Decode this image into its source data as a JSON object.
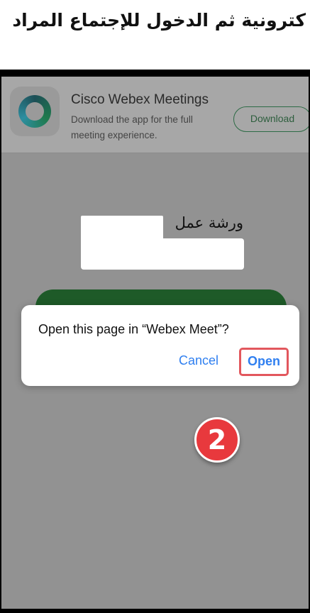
{
  "caption": {
    "text": "كترونية ثم الدخول للإجتماع المراد"
  },
  "banner": {
    "app_name": "Cisco Webex Meetings",
    "description": "Download the app for the full meeting experience.",
    "download_label": "Download",
    "icon": "webex-logo-icon"
  },
  "page": {
    "workshop_label": "ورشة عمل"
  },
  "dialog": {
    "message": "Open this page in “Webex Meet”?",
    "cancel_label": "Cancel",
    "open_label": "Open"
  },
  "step": {
    "number": "2"
  },
  "colors": {
    "join_button": "#1e5a28",
    "dialog_link": "#2f7ff0",
    "highlight_box": "#e2575d",
    "step_badge": "#e8393d"
  }
}
